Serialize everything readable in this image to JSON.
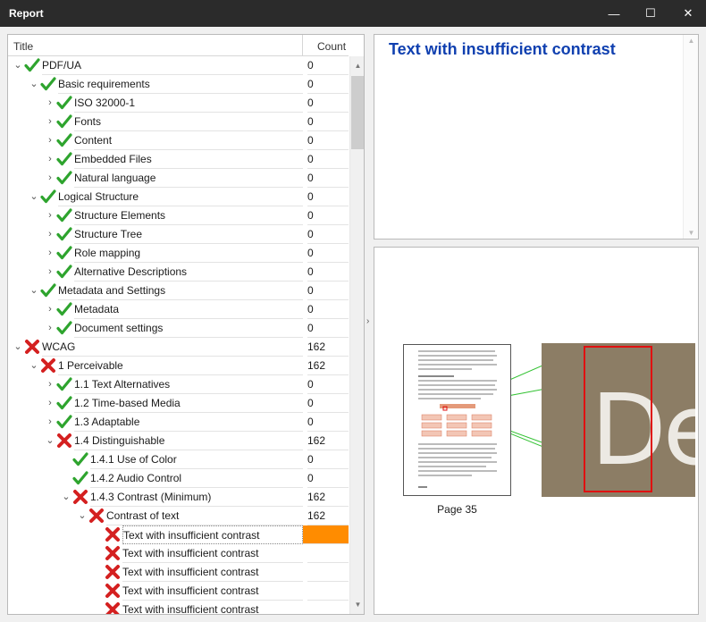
{
  "window": {
    "title": "Report",
    "minimize_glyph": "—",
    "maximize_glyph": "☐",
    "close_glyph": "✕"
  },
  "tree": {
    "header": {
      "title": "Title",
      "count": "Count"
    },
    "rows": [
      {
        "level": 0,
        "expander": "open",
        "status": "pass",
        "label": "PDF/UA",
        "count": "0"
      },
      {
        "level": 1,
        "expander": "open",
        "status": "pass",
        "label": "Basic requirements",
        "count": "0"
      },
      {
        "level": 2,
        "expander": "closed",
        "status": "pass",
        "label": "ISO 32000-1",
        "count": "0"
      },
      {
        "level": 2,
        "expander": "closed",
        "status": "pass",
        "label": "Fonts",
        "count": "0"
      },
      {
        "level": 2,
        "expander": "closed",
        "status": "pass",
        "label": "Content",
        "count": "0"
      },
      {
        "level": 2,
        "expander": "closed",
        "status": "pass",
        "label": "Embedded Files",
        "count": "0"
      },
      {
        "level": 2,
        "expander": "closed",
        "status": "pass",
        "label": "Natural language",
        "count": "0"
      },
      {
        "level": 1,
        "expander": "open",
        "status": "pass",
        "label": "Logical Structure",
        "count": "0"
      },
      {
        "level": 2,
        "expander": "closed",
        "status": "pass",
        "label": "Structure Elements",
        "count": "0"
      },
      {
        "level": 2,
        "expander": "closed",
        "status": "pass",
        "label": "Structure Tree",
        "count": "0"
      },
      {
        "level": 2,
        "expander": "closed",
        "status": "pass",
        "label": "Role mapping",
        "count": "0"
      },
      {
        "level": 2,
        "expander": "closed",
        "status": "pass",
        "label": "Alternative Descriptions",
        "count": "0"
      },
      {
        "level": 1,
        "expander": "open",
        "status": "pass",
        "label": "Metadata and Settings",
        "count": "0"
      },
      {
        "level": 2,
        "expander": "closed",
        "status": "pass",
        "label": "Metadata",
        "count": "0"
      },
      {
        "level": 2,
        "expander": "closed",
        "status": "pass",
        "label": "Document settings",
        "count": "0"
      },
      {
        "level": 0,
        "expander": "open",
        "status": "fail",
        "label": "WCAG",
        "count": "162"
      },
      {
        "level": 1,
        "expander": "open",
        "status": "fail",
        "label": "1 Perceivable",
        "count": "162"
      },
      {
        "level": 2,
        "expander": "closed",
        "status": "pass",
        "label": "1.1 Text Alternatives",
        "count": "0"
      },
      {
        "level": 2,
        "expander": "closed",
        "status": "pass",
        "label": "1.2 Time-based Media",
        "count": "0"
      },
      {
        "level": 2,
        "expander": "closed",
        "status": "pass",
        "label": "1.3 Adaptable",
        "count": "0"
      },
      {
        "level": 2,
        "expander": "open",
        "status": "fail",
        "label": "1.4 Distinguishable",
        "count": "162"
      },
      {
        "level": 3,
        "expander": "none",
        "status": "pass",
        "label": "1.4.1 Use of Color",
        "count": "0"
      },
      {
        "level": 3,
        "expander": "none",
        "status": "pass",
        "label": "1.4.2 Audio Control",
        "count": "0"
      },
      {
        "level": 3,
        "expander": "open",
        "status": "fail",
        "label": "1.4.3 Contrast (Minimum)",
        "count": "162"
      },
      {
        "level": 4,
        "expander": "open",
        "status": "fail",
        "label": "Contrast of text",
        "count": "162"
      },
      {
        "level": 5,
        "expander": "none",
        "status": "fail",
        "label": "Text with insufficient contrast",
        "count": "",
        "selected": true
      },
      {
        "level": 5,
        "expander": "none",
        "status": "fail",
        "label": "Text with insufficient contrast",
        "count": ""
      },
      {
        "level": 5,
        "expander": "none",
        "status": "fail",
        "label": "Text with insufficient contrast",
        "count": ""
      },
      {
        "level": 5,
        "expander": "none",
        "status": "fail",
        "label": "Text with insufficient contrast",
        "count": ""
      },
      {
        "level": 5,
        "expander": "none",
        "status": "fail",
        "label": "Text with insufficient contrast",
        "count": ""
      }
    ]
  },
  "detail": {
    "heading": "Text with insufficient contrast"
  },
  "preview": {
    "page_label": "Page 35",
    "zoom_text": "De"
  },
  "colors": {
    "pass": "#2ea42e",
    "fail": "#d42020",
    "selected_count": "#ff8c00",
    "heading": "#1040b0"
  }
}
